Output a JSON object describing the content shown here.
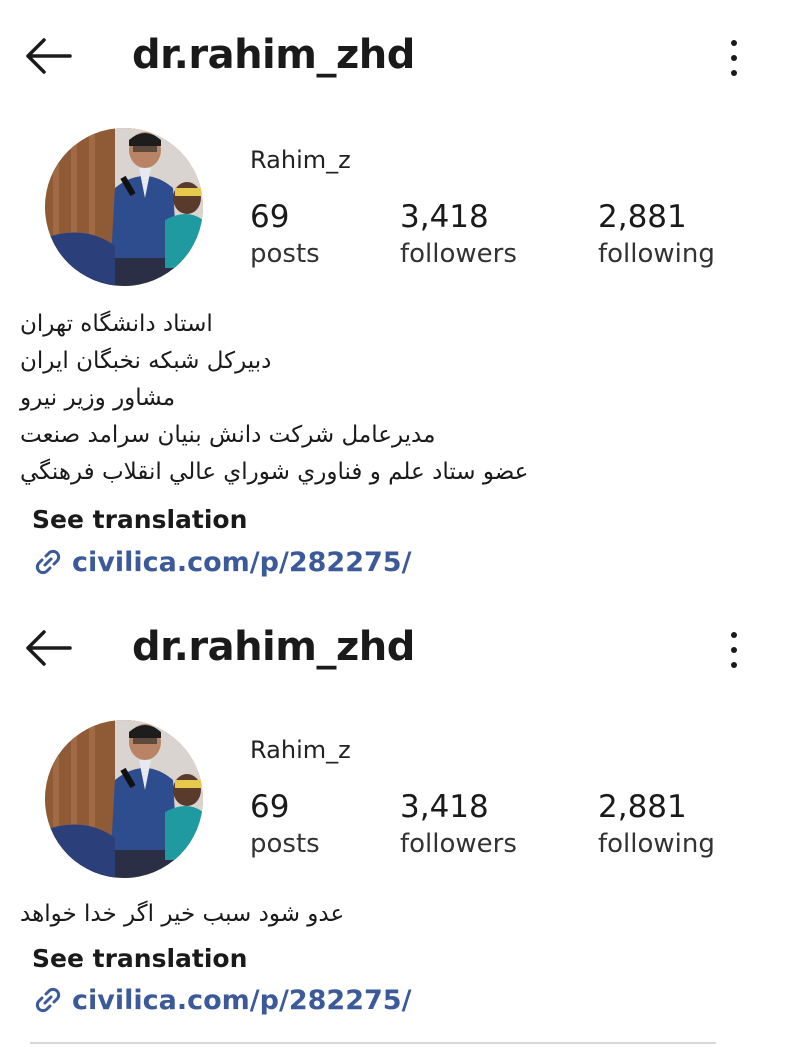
{
  "profile_top": {
    "username": "dr.rahim_zhd",
    "display_name": "Rahim_z",
    "stats": [
      {
        "value": "69",
        "label": "posts"
      },
      {
        "value": "3,418",
        "label": "followers"
      },
      {
        "value": "2,881",
        "label": "following"
      }
    ],
    "bio_lines": [
      "استاد دانشگاه تهران",
      "دبیرکل شبکه نخبگان ایران",
      "مشاور وزیر نیرو",
      "مدیرعامل شرکت دانش بنیان سرامد صنعت",
      "عضو ستاد علم و فناوري شوراي عالي انقلاب فرهنگي"
    ],
    "see_translation": "See translation",
    "link": "civilica.com/p/282275/"
  },
  "profile_bottom": {
    "username": "dr.rahim_zhd",
    "display_name": "Rahim_z",
    "stats": [
      {
        "value": "69",
        "label": "posts"
      },
      {
        "value": "3,418",
        "label": "followers"
      },
      {
        "value": "2,881",
        "label": "following"
      }
    ],
    "bio_lines": [
      "عدو شود سبب خیر اگر خدا خواهد"
    ],
    "see_translation": "See translation",
    "link": "civilica.com/p/282275/"
  },
  "icons": {
    "back": "back-arrow-icon",
    "more": "more-options-icon",
    "link": "link-icon"
  },
  "colors": {
    "link": "#3c5a9a",
    "text": "#1a1a1a"
  }
}
